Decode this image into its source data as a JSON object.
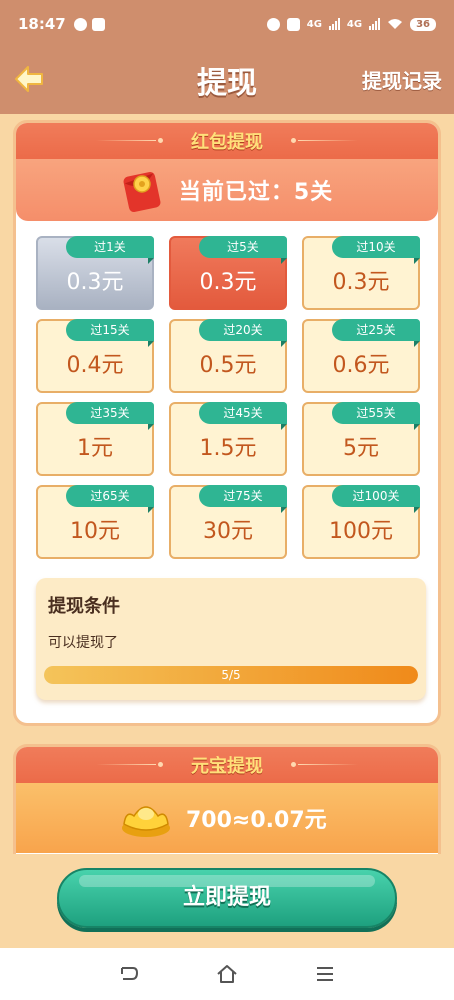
{
  "status_bar": {
    "time": "18:47",
    "network_1": "4G",
    "network_2": "4G",
    "battery": "36"
  },
  "header": {
    "title": "提现",
    "history_link": "提现记录"
  },
  "redpacket_panel": {
    "title": "红包提现",
    "progress_text": "当前已过：5关",
    "tiles": [
      {
        "tag": "过1关",
        "amount": "0.3元",
        "state": "used"
      },
      {
        "tag": "过5关",
        "amount": "0.3元",
        "state": "current"
      },
      {
        "tag": "过10关",
        "amount": "0.3元",
        "state": "locked"
      },
      {
        "tag": "过15关",
        "amount": "0.4元",
        "state": "locked"
      },
      {
        "tag": "过20关",
        "amount": "0.5元",
        "state": "locked"
      },
      {
        "tag": "过25关",
        "amount": "0.6元",
        "state": "locked"
      },
      {
        "tag": "过35关",
        "amount": "1元",
        "state": "locked"
      },
      {
        "tag": "过45关",
        "amount": "1.5元",
        "state": "locked"
      },
      {
        "tag": "过55关",
        "amount": "5元",
        "state": "locked"
      },
      {
        "tag": "过65关",
        "amount": "10元",
        "state": "locked"
      },
      {
        "tag": "过75关",
        "amount": "30元",
        "state": "locked"
      },
      {
        "tag": "过100关",
        "amount": "100元",
        "state": "locked"
      }
    ],
    "condition": {
      "title": "提现条件",
      "status": "可以提现了",
      "progress_label": "5/5",
      "progress_fraction": 1.0
    }
  },
  "gold_panel": {
    "title": "元宝提现",
    "exchange_text": "700≈0.07元"
  },
  "withdraw_button": "立即提现",
  "nav": {
    "icons": [
      "back-icon",
      "home-icon",
      "menu-icon"
    ]
  },
  "colors": {
    "accent_green": "#2fb593",
    "header_brown": "#cf8e6d",
    "panel_red": "#ec6b49",
    "gold": "#f8a44c"
  }
}
